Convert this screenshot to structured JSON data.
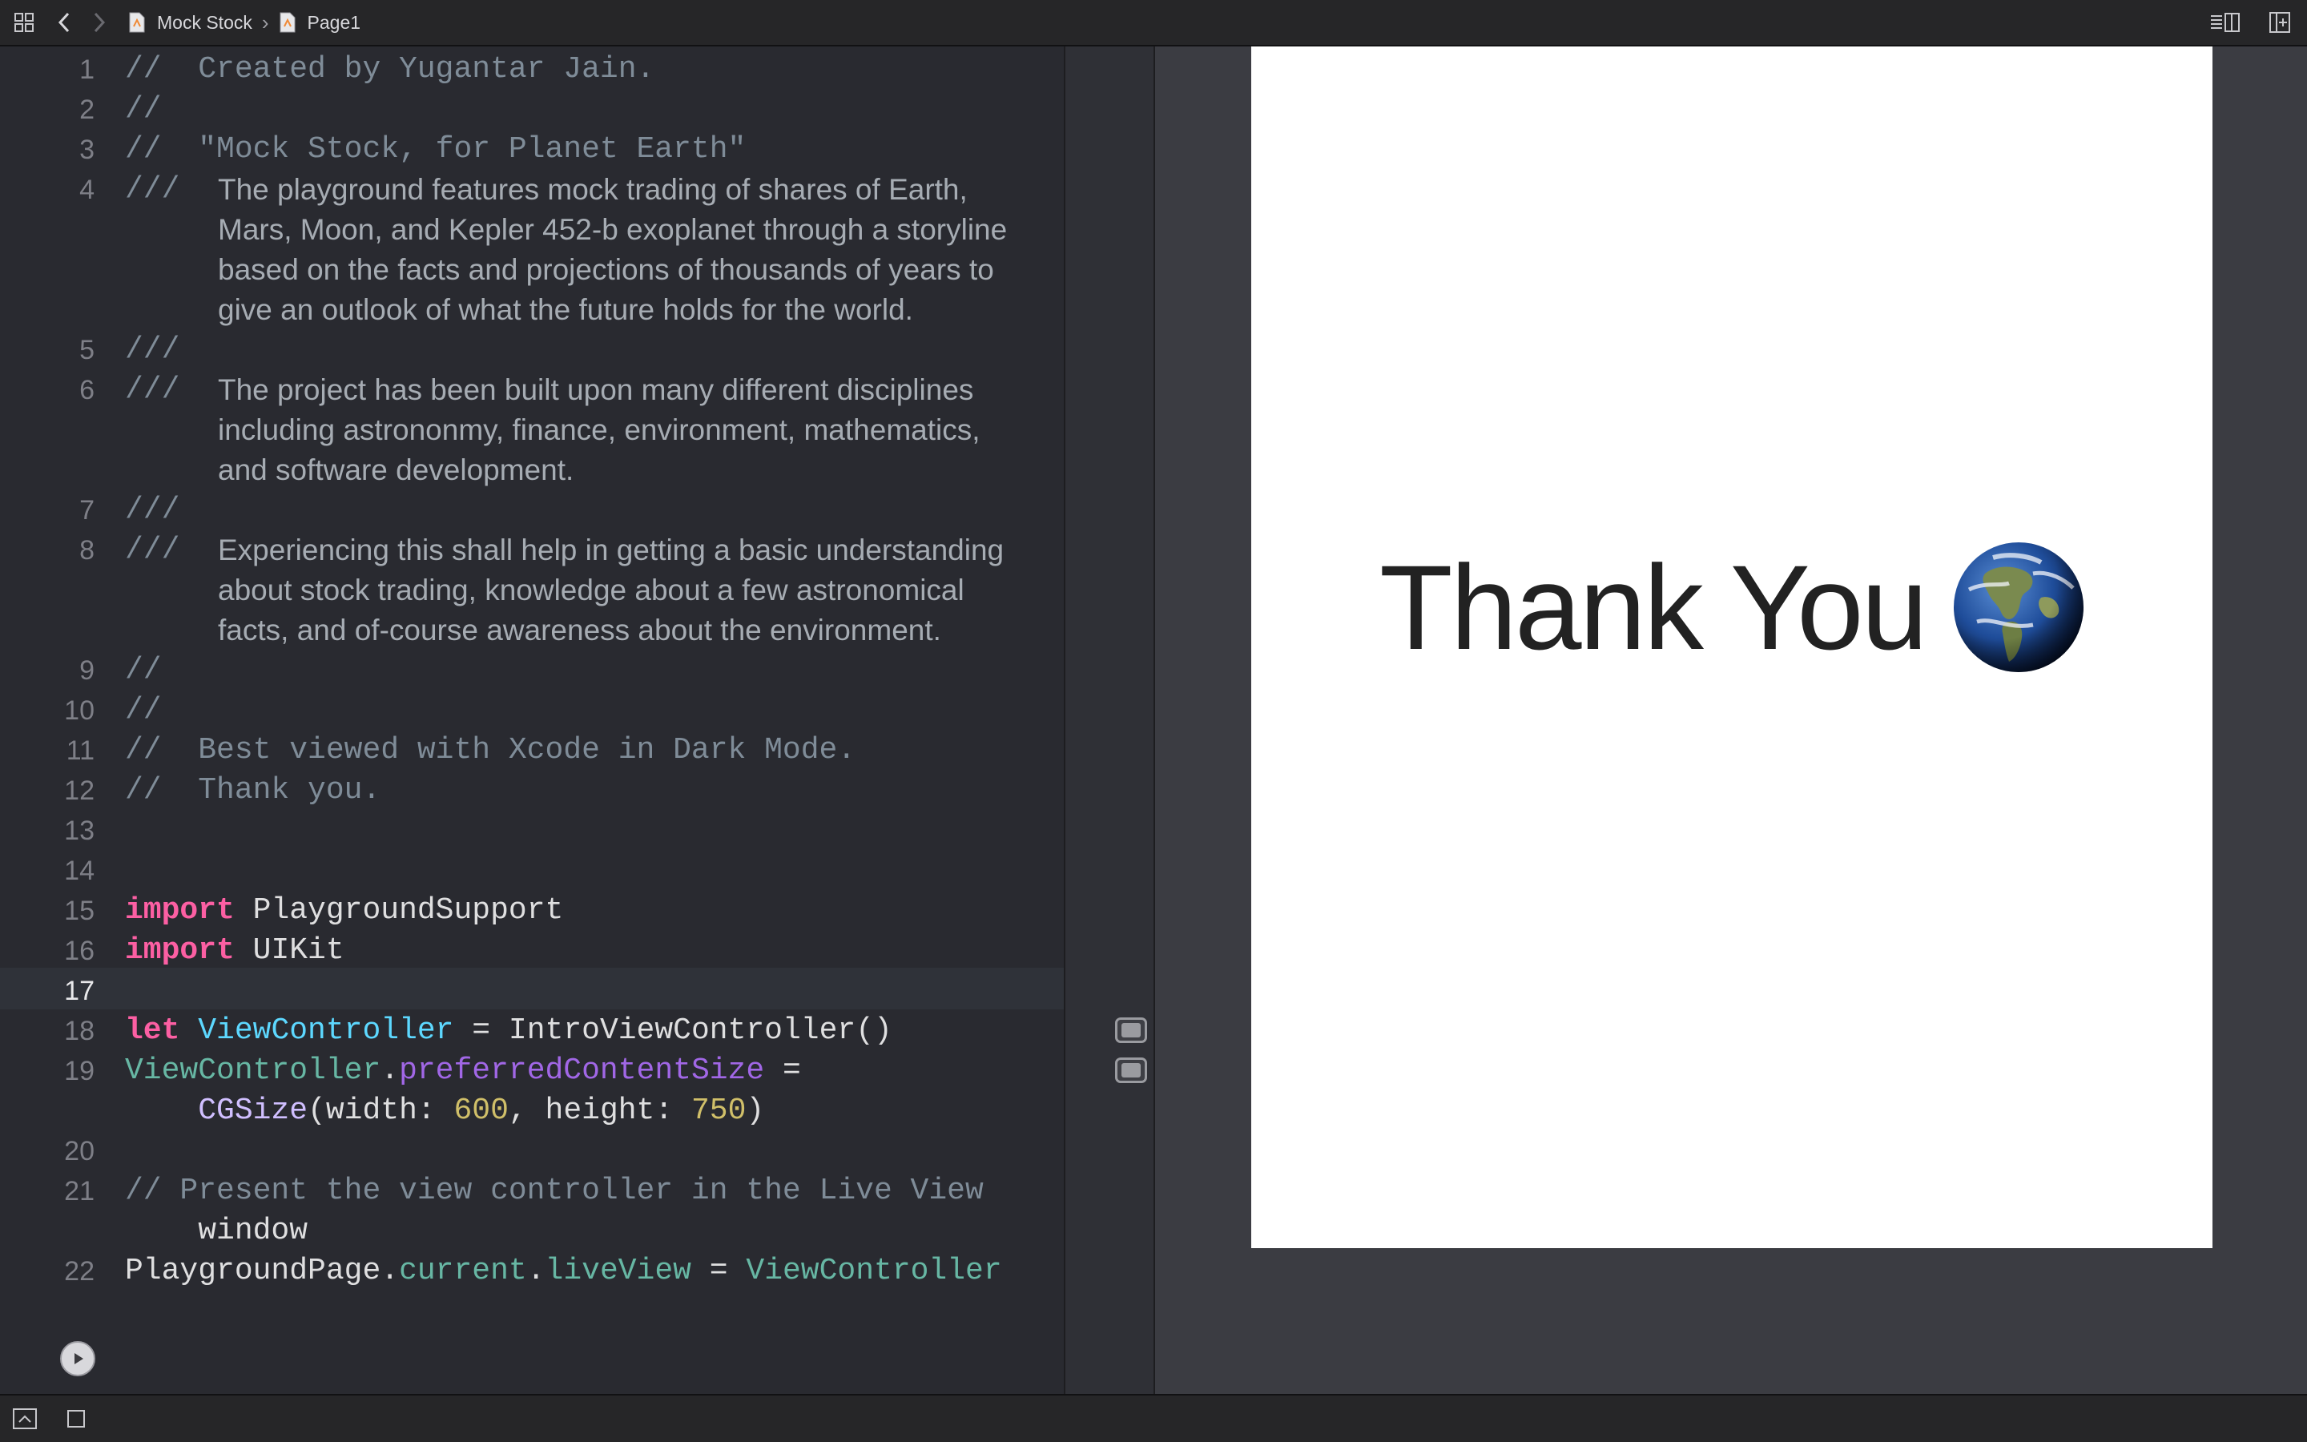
{
  "toolbar": {
    "breadcrumb": [
      "Mock Stock",
      "Page1"
    ]
  },
  "editor": {
    "lines": [
      {
        "n": "1",
        "text": "//  Created by Yugantar Jain."
      },
      {
        "n": "2",
        "text": "//"
      },
      {
        "n": "3",
        "text": "//  \"Mock Stock, for Planet Earth\""
      },
      {
        "n": "4",
        "doc": [
          "The playground features mock trading of shares of Earth,",
          "Mars, Moon, and Kepler 452-b exoplanet through a storyline",
          "based on the facts and projections of thousands of years to",
          "give an outlook of what the future holds for the world."
        ]
      },
      {
        "n": "5",
        "doc": []
      },
      {
        "n": "6",
        "doc": [
          "The project has been built upon many different disciplines",
          "including astrononmy, finance, environment, mathematics,",
          "and software development."
        ]
      },
      {
        "n": "7",
        "doc": []
      },
      {
        "n": "8",
        "doc": [
          "Experiencing this shall help in getting a basic understanding",
          "about stock trading, knowledge about a few astronomical",
          "facts, and of-course awareness about the environment."
        ]
      },
      {
        "n": "9",
        "text": "//"
      },
      {
        "n": "10",
        "text": "//"
      },
      {
        "n": "11",
        "text": "//  Best viewed with Xcode in Dark Mode."
      },
      {
        "n": "12",
        "text": "//  Thank you."
      },
      {
        "n": "13",
        "text": ""
      },
      {
        "n": "14",
        "text": ""
      },
      {
        "n": "15",
        "text": "import PlaygroundSupport"
      },
      {
        "n": "16",
        "text": "import UIKit"
      },
      {
        "n": "17",
        "text": ""
      },
      {
        "n": "18",
        "text": "let ViewController = IntroViewController()"
      },
      {
        "n": "19",
        "text": "ViewController.preferredContentSize =\n    CGSize(width: 600, height: 750)"
      },
      {
        "n": "20",
        "text": ""
      },
      {
        "n": "21",
        "text": "// Present the view controller in the Live View\n    window"
      },
      {
        "n": "22",
        "text": "PlaygroundPage.current.liveView = ViewController"
      }
    ],
    "doc_prefix": "///"
  },
  "live_view": {
    "message": "Thank You"
  },
  "colors": {
    "editor_bg": "#292a30",
    "keyword": "#fc5fa3",
    "comment": "#7f8c98",
    "number": "#d0bf69"
  }
}
